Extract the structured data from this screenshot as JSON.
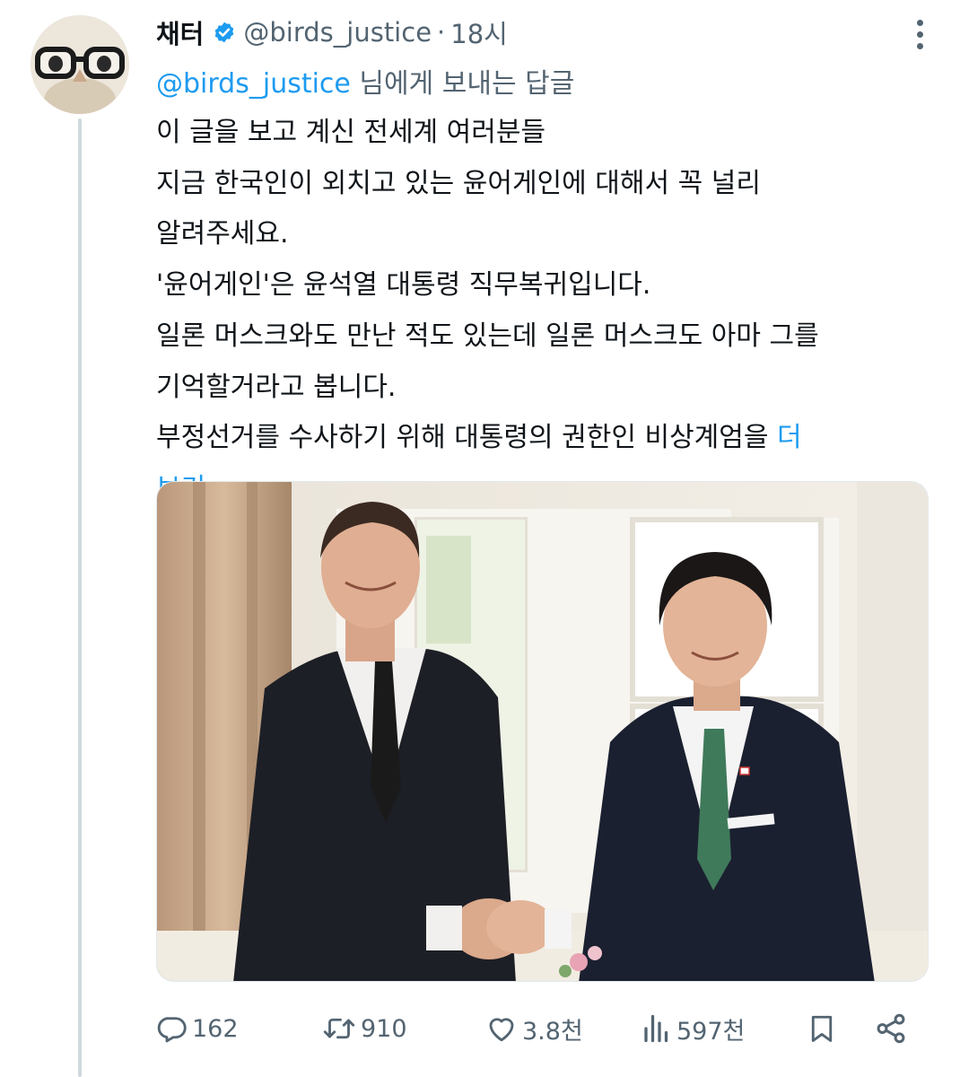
{
  "tweet": {
    "author_name": "채터",
    "handle": "@birds_justice",
    "separator": "·",
    "time": "18시",
    "reply_mention": "@birds_justice",
    "reply_suffix": " 님에게 보내는 답글",
    "lines": [
      "이 글을 보고 계신 전세계 여러분들",
      "지금 한국인이 외치고 있는 윤어게인에 대해서 꼭 널리",
      "알려주세요.",
      "'윤어게인'은 윤석열 대통령 직무복귀입니다.",
      "일론 머스크와도 만난 적도 있는데 일론 머스크도 아마 그를",
      "기억할거라고 봅니다.",
      "부정선거를 수사하기 위해 대통령의 권한인 비상계엄을 "
    ],
    "show_more_part1": "더",
    "show_more_part2": "보기",
    "media": {
      "icon": "photo-two-men-handshake"
    }
  },
  "actions": {
    "reply_count": "162",
    "retweet_count": "910",
    "like_count": "3.8천",
    "view_count": "597천"
  },
  "colors": {
    "accent": "#1d9bf0",
    "muted": "#536471",
    "text": "#0f1419",
    "thread_line": "#cfd9de"
  }
}
